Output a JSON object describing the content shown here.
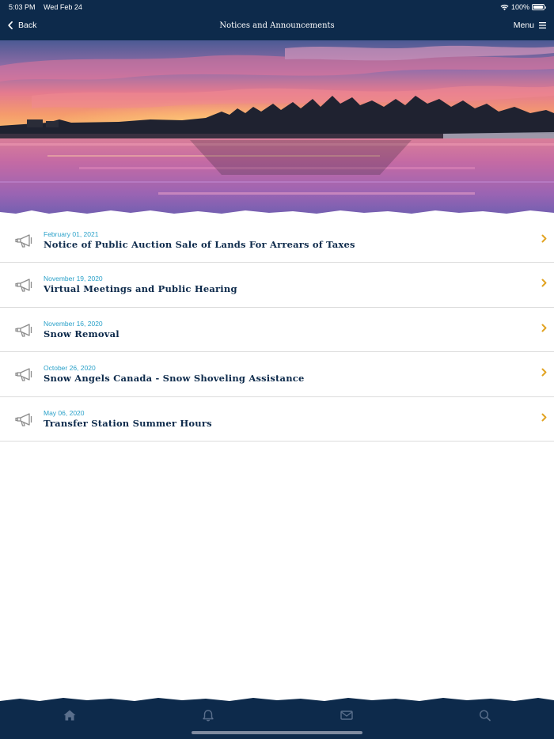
{
  "status_bar": {
    "time": "5:03 PM",
    "date": "Wed Feb 24",
    "battery": "100%"
  },
  "nav": {
    "back_label": "Back",
    "title": "Notices and Announcements",
    "menu_label": "Menu"
  },
  "notices": [
    {
      "date": "February 01, 2021",
      "title": "Notice of Public Auction Sale of Lands For Arrears of Taxes",
      "icon": "megaphone-icon"
    },
    {
      "date": "November 19, 2020",
      "title": "Virtual Meetings and Public Hearing",
      "icon": "megaphone-icon"
    },
    {
      "date": "November 16, 2020",
      "title": "Snow Removal",
      "icon": "megaphone-icon"
    },
    {
      "date": "October 26, 2020",
      "title": "Snow Angels Canada - Snow Shoveling Assistance",
      "icon": "megaphone-icon"
    },
    {
      "date": "May 06, 2020",
      "title": "Transfer Station Summer Hours",
      "icon": "megaphone-icon"
    }
  ],
  "tabs": [
    {
      "icon": "home-icon",
      "active": true
    },
    {
      "icon": "bell-icon",
      "active": false
    },
    {
      "icon": "envelope-icon",
      "active": false
    },
    {
      "icon": "search-icon",
      "active": false
    }
  ],
  "colors": {
    "navy": "#0d2a4b",
    "date_blue": "#2aa1c9",
    "chevron_gold": "#e2a423",
    "icon_gray": "#8d8d8d",
    "tab_icon": "#5a6f8c"
  }
}
